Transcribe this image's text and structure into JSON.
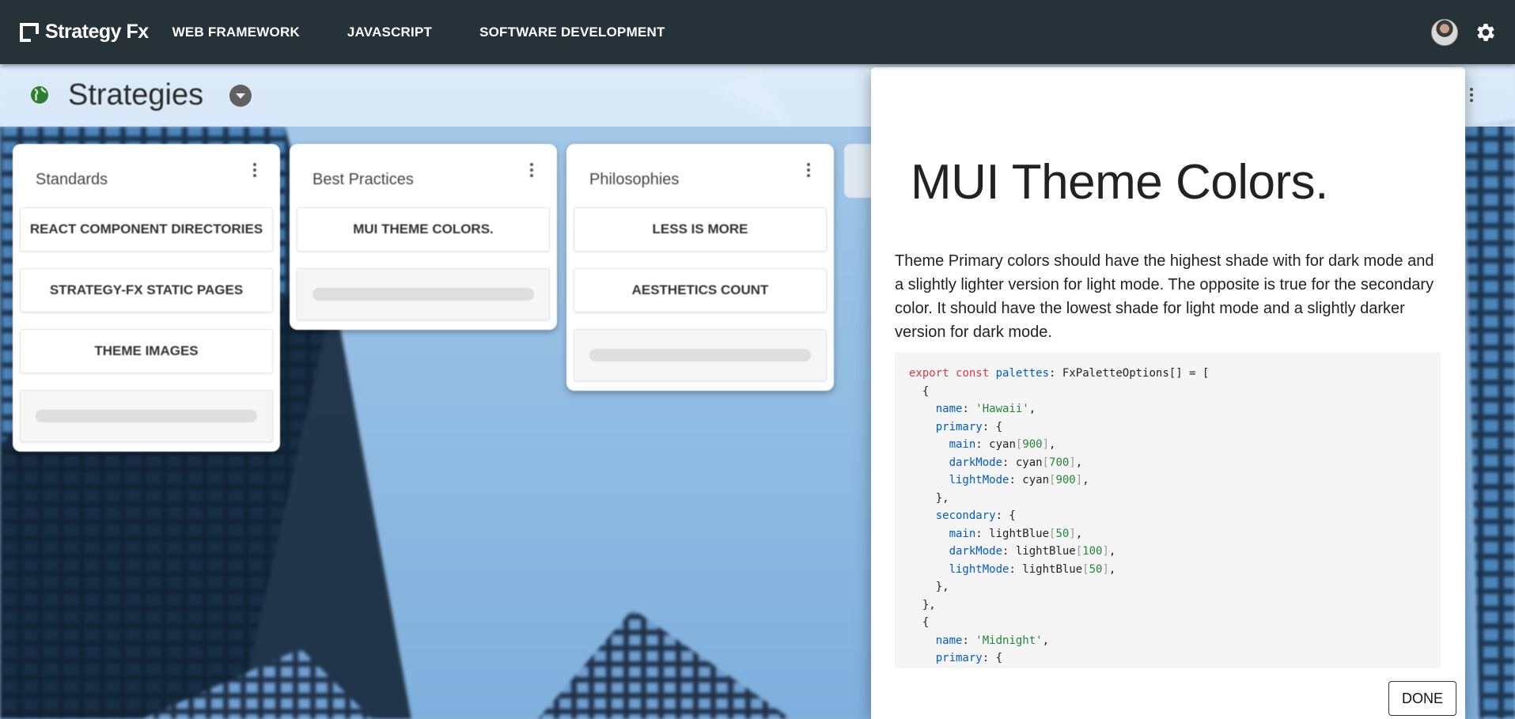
{
  "brand": {
    "name": "Strategy Fx"
  },
  "nav": {
    "items": [
      "WEB FRAMEWORK",
      "JAVASCRIPT",
      "SOFTWARE DEVELOPMENT"
    ]
  },
  "header": {
    "title": "Strategies"
  },
  "columns": [
    {
      "title": "Standards",
      "cards": [
        "REACT COMPONENT DIRECTORIES",
        "STRATEGY-FX STATIC PAGES",
        "THEME IMAGES"
      ]
    },
    {
      "title": "Best Practices",
      "cards": [
        "MUI THEME COLORS."
      ]
    },
    {
      "title": "Philosophies",
      "cards": [
        "LESS IS MORE",
        "AESTHETICS COUNT"
      ]
    }
  ],
  "drawer": {
    "title": "MUI Theme Colors.",
    "description": "Theme Primary colors should have the highest shade with for dark mode and a slightly lighter version for light mode. The opposite is true for the secondary color. It should have the lowest shade for light mode and a slightly darker version for dark mode.",
    "code_lines": [
      "export const palettes: FxPaletteOptions[] = [",
      "  {",
      "    name: 'Hawaii',",
      "    primary: {",
      "      main: cyan[900],",
      "      darkMode: cyan[700],",
      "      lightMode: cyan[900],",
      "    },",
      "    secondary: {",
      "      main: lightBlue[50],",
      "      darkMode: lightBlue[100],",
      "      lightMode: lightBlue[50],",
      "    },",
      "  },",
      "  {",
      "    name: 'Midnight',",
      "    primary: {"
    ],
    "done_label": "DONE"
  },
  "colors": {
    "appbar": "#263238",
    "code_keyword": "#d73a49",
    "code_property": "#005cc5",
    "code_number": "#22863a"
  },
  "icons": [
    "logo-icon",
    "avatar",
    "gear-icon",
    "globe-icon",
    "chevron-down-icon",
    "more-vert-icon"
  ]
}
